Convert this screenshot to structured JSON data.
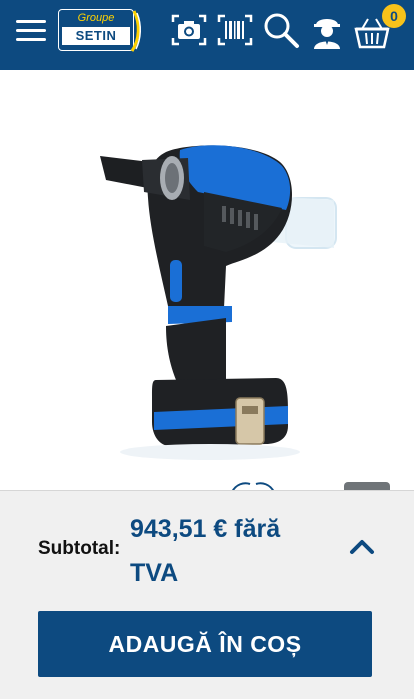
{
  "header": {
    "logo_top": "Groupe",
    "logo_name": "SETIN",
    "cart_count": "0"
  },
  "icons": {
    "menu": "hamburger-menu-icon",
    "camera": "camera-icon",
    "barcode": "barcode-scanner-icon",
    "search": "search-icon",
    "account": "worker-account-icon",
    "cart": "basket-icon"
  },
  "colors": {
    "brand": "#0d4a80",
    "badge": "#f7c21a",
    "bar_bg": "#f0f0f0"
  },
  "summary": {
    "subtotal_label": "Subtotal:",
    "price": "943,51 € fără TVA"
  },
  "actions": {
    "add_to_cart": "ADAUGĂ ÎN COȘ"
  }
}
